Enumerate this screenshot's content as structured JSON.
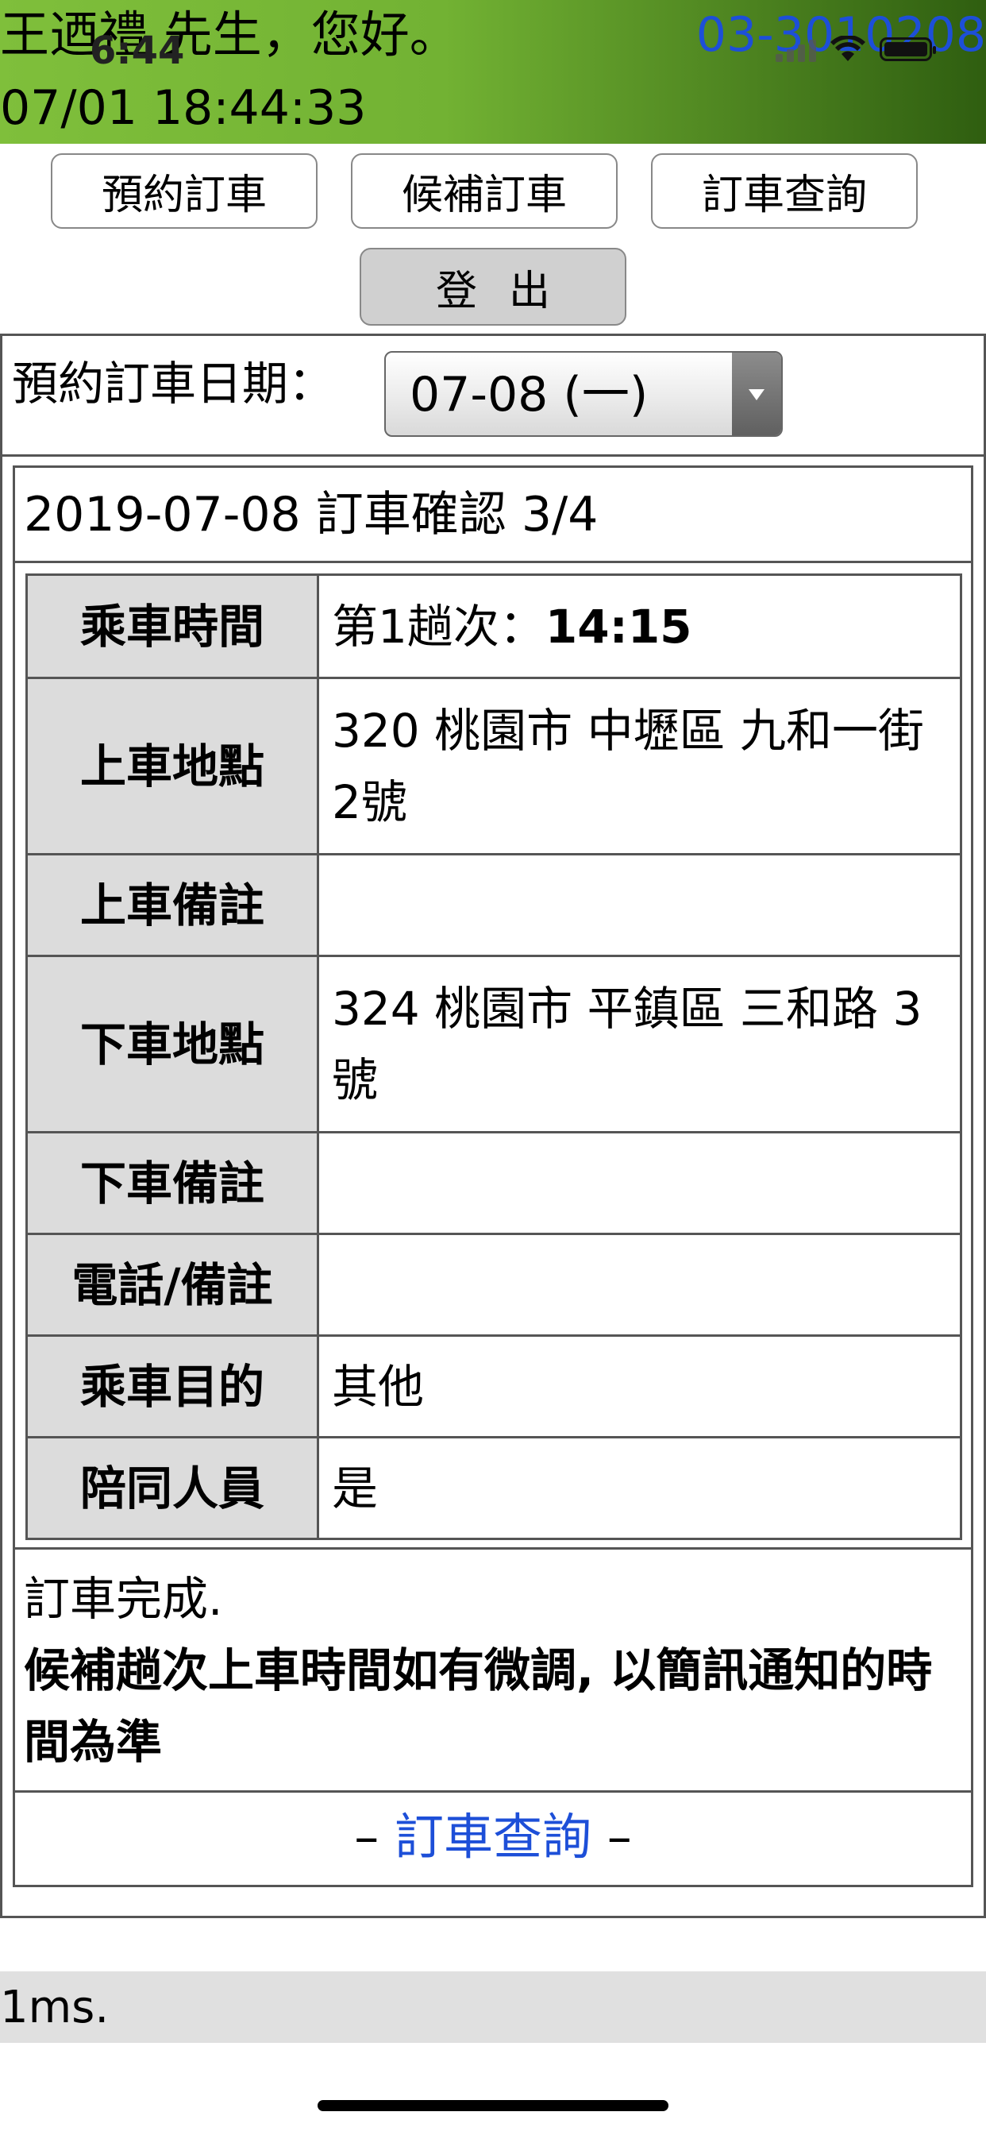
{
  "status_bar": {
    "time": "6:44"
  },
  "header": {
    "greeting": "王迺禮 先生，您好。",
    "phone": "03-3010208",
    "datetime": "07/01 18:44:33"
  },
  "nav": {
    "reserve": "預約訂車",
    "waitlist": "候補訂車",
    "query": "訂車查詢",
    "logout": "登出"
  },
  "date_picker": {
    "label": "預約訂車日期：",
    "selected": "07-08 (一)"
  },
  "confirmation": {
    "title": "2019-07-08 訂車確認 3/4",
    "rows": [
      {
        "key": "乘車時間",
        "value_prefix": "第1趟次：",
        "value_bold": "14:15"
      },
      {
        "key": "上車地點",
        "value": "320 桃園市 中壢區 九和一街 2號"
      },
      {
        "key": "上車備註",
        "value": ""
      },
      {
        "key": "下車地點",
        "value": "324 桃園市 平鎮區 三和路 3號"
      },
      {
        "key": "下車備註",
        "value": ""
      },
      {
        "key": "電話/備註",
        "value": ""
      },
      {
        "key": "乘車目的",
        "value": "其他"
      },
      {
        "key": "陪同人員",
        "value": "是"
      }
    ],
    "done_text": "訂車完成.",
    "done_note": "候補趟次上車時間如有微調, 以簡訊通知的時間為準",
    "query_link": "訂車查詢",
    "dash": "–"
  },
  "footer": {
    "timing": "1ms."
  }
}
